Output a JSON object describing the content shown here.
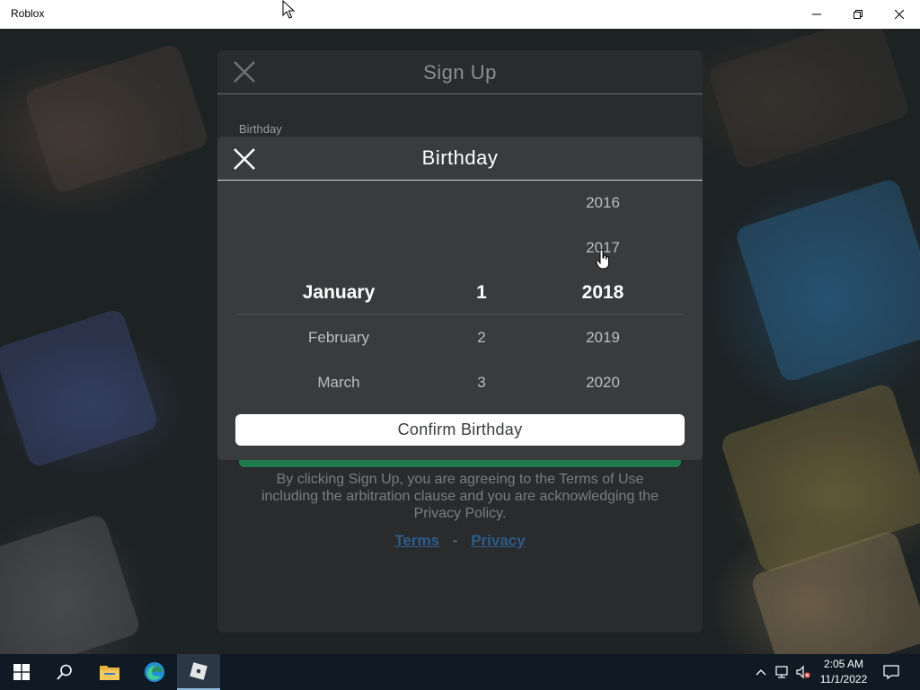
{
  "window": {
    "title": "Roblox",
    "controls": [
      "minimize-icon",
      "restore-icon",
      "close-icon"
    ]
  },
  "signup": {
    "title": "Sign Up",
    "birthday_label": "Birthday",
    "legal_text": "By clicking Sign Up, you are agreeing to the Terms of Use including the arbitration clause and you are acknowledging the Privacy Policy.",
    "terms_link": "Terms",
    "separator": "-",
    "privacy_link": "Privacy"
  },
  "birthday_modal": {
    "title": "Birthday",
    "months": {
      "items": [
        "January",
        "February",
        "March"
      ],
      "selected": "January"
    },
    "days": {
      "items": [
        "1",
        "2",
        "3"
      ],
      "selected": "1"
    },
    "years": {
      "items": [
        "2016",
        "2017",
        "2018",
        "2019",
        "2020"
      ],
      "selected": "2018"
    },
    "confirm_label": "Confirm Birthday"
  },
  "taskbar": {
    "icons": [
      "windows-start-icon",
      "search-icon",
      "file-explorer-icon",
      "edge-browser-icon",
      "roblox-app-icon"
    ],
    "active": "roblox-app-icon",
    "tray": [
      "chevron-up-icon",
      "network-icon",
      "volume-muted-icon",
      "notification-icon"
    ],
    "time": "2:05 AM",
    "date": "11/1/2022"
  },
  "colors": {
    "modal_bg": "#393b3d",
    "panel_bg": "#2a2b2d",
    "confirm_bg": "#ffffff",
    "link": "#2c5d8a",
    "taskbar": "#0f1a24"
  }
}
